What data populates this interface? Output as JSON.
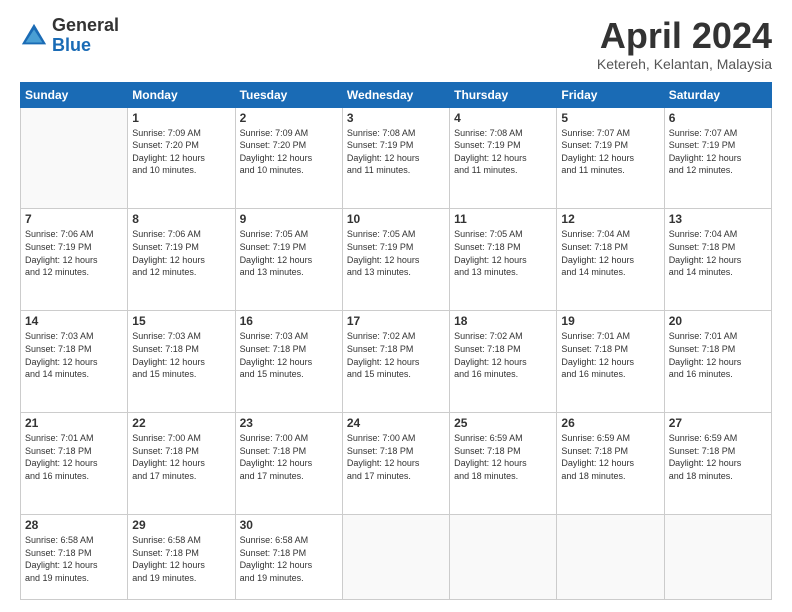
{
  "logo": {
    "general": "General",
    "blue": "Blue"
  },
  "header": {
    "title": "April 2024",
    "location": "Ketereh, Kelantan, Malaysia"
  },
  "weekdays": [
    "Sunday",
    "Monday",
    "Tuesday",
    "Wednesday",
    "Thursday",
    "Friday",
    "Saturday"
  ],
  "weeks": [
    [
      {
        "day": "",
        "info": ""
      },
      {
        "day": "1",
        "info": "Sunrise: 7:09 AM\nSunset: 7:20 PM\nDaylight: 12 hours\nand 10 minutes."
      },
      {
        "day": "2",
        "info": "Sunrise: 7:09 AM\nSunset: 7:20 PM\nDaylight: 12 hours\nand 10 minutes."
      },
      {
        "day": "3",
        "info": "Sunrise: 7:08 AM\nSunset: 7:19 PM\nDaylight: 12 hours\nand 11 minutes."
      },
      {
        "day": "4",
        "info": "Sunrise: 7:08 AM\nSunset: 7:19 PM\nDaylight: 12 hours\nand 11 minutes."
      },
      {
        "day": "5",
        "info": "Sunrise: 7:07 AM\nSunset: 7:19 PM\nDaylight: 12 hours\nand 11 minutes."
      },
      {
        "day": "6",
        "info": "Sunrise: 7:07 AM\nSunset: 7:19 PM\nDaylight: 12 hours\nand 12 minutes."
      }
    ],
    [
      {
        "day": "7",
        "info": "Sunrise: 7:06 AM\nSunset: 7:19 PM\nDaylight: 12 hours\nand 12 minutes."
      },
      {
        "day": "8",
        "info": "Sunrise: 7:06 AM\nSunset: 7:19 PM\nDaylight: 12 hours\nand 12 minutes."
      },
      {
        "day": "9",
        "info": "Sunrise: 7:05 AM\nSunset: 7:19 PM\nDaylight: 12 hours\nand 13 minutes."
      },
      {
        "day": "10",
        "info": "Sunrise: 7:05 AM\nSunset: 7:19 PM\nDaylight: 12 hours\nand 13 minutes."
      },
      {
        "day": "11",
        "info": "Sunrise: 7:05 AM\nSunset: 7:18 PM\nDaylight: 12 hours\nand 13 minutes."
      },
      {
        "day": "12",
        "info": "Sunrise: 7:04 AM\nSunset: 7:18 PM\nDaylight: 12 hours\nand 14 minutes."
      },
      {
        "day": "13",
        "info": "Sunrise: 7:04 AM\nSunset: 7:18 PM\nDaylight: 12 hours\nand 14 minutes."
      }
    ],
    [
      {
        "day": "14",
        "info": "Sunrise: 7:03 AM\nSunset: 7:18 PM\nDaylight: 12 hours\nand 14 minutes."
      },
      {
        "day": "15",
        "info": "Sunrise: 7:03 AM\nSunset: 7:18 PM\nDaylight: 12 hours\nand 15 minutes."
      },
      {
        "day": "16",
        "info": "Sunrise: 7:03 AM\nSunset: 7:18 PM\nDaylight: 12 hours\nand 15 minutes."
      },
      {
        "day": "17",
        "info": "Sunrise: 7:02 AM\nSunset: 7:18 PM\nDaylight: 12 hours\nand 15 minutes."
      },
      {
        "day": "18",
        "info": "Sunrise: 7:02 AM\nSunset: 7:18 PM\nDaylight: 12 hours\nand 16 minutes."
      },
      {
        "day": "19",
        "info": "Sunrise: 7:01 AM\nSunset: 7:18 PM\nDaylight: 12 hours\nand 16 minutes."
      },
      {
        "day": "20",
        "info": "Sunrise: 7:01 AM\nSunset: 7:18 PM\nDaylight: 12 hours\nand 16 minutes."
      }
    ],
    [
      {
        "day": "21",
        "info": "Sunrise: 7:01 AM\nSunset: 7:18 PM\nDaylight: 12 hours\nand 16 minutes."
      },
      {
        "day": "22",
        "info": "Sunrise: 7:00 AM\nSunset: 7:18 PM\nDaylight: 12 hours\nand 17 minutes."
      },
      {
        "day": "23",
        "info": "Sunrise: 7:00 AM\nSunset: 7:18 PM\nDaylight: 12 hours\nand 17 minutes."
      },
      {
        "day": "24",
        "info": "Sunrise: 7:00 AM\nSunset: 7:18 PM\nDaylight: 12 hours\nand 17 minutes."
      },
      {
        "day": "25",
        "info": "Sunrise: 6:59 AM\nSunset: 7:18 PM\nDaylight: 12 hours\nand 18 minutes."
      },
      {
        "day": "26",
        "info": "Sunrise: 6:59 AM\nSunset: 7:18 PM\nDaylight: 12 hours\nand 18 minutes."
      },
      {
        "day": "27",
        "info": "Sunrise: 6:59 AM\nSunset: 7:18 PM\nDaylight: 12 hours\nand 18 minutes."
      }
    ],
    [
      {
        "day": "28",
        "info": "Sunrise: 6:58 AM\nSunset: 7:18 PM\nDaylight: 12 hours\nand 19 minutes."
      },
      {
        "day": "29",
        "info": "Sunrise: 6:58 AM\nSunset: 7:18 PM\nDaylight: 12 hours\nand 19 minutes."
      },
      {
        "day": "30",
        "info": "Sunrise: 6:58 AM\nSunset: 7:18 PM\nDaylight: 12 hours\nand 19 minutes."
      },
      {
        "day": "",
        "info": ""
      },
      {
        "day": "",
        "info": ""
      },
      {
        "day": "",
        "info": ""
      },
      {
        "day": "",
        "info": ""
      }
    ]
  ]
}
